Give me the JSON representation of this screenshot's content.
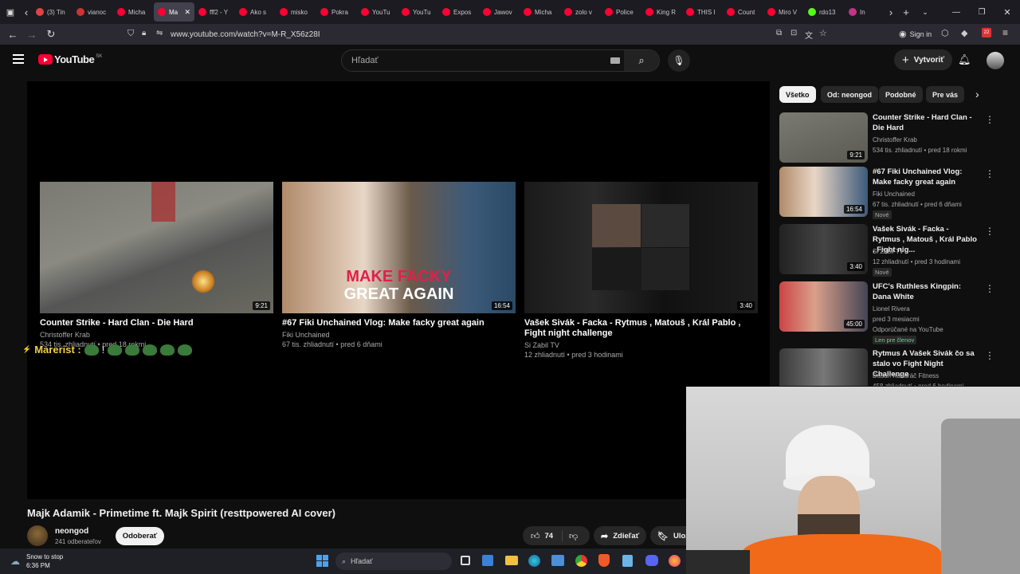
{
  "browser": {
    "tabs": [
      {
        "label": "(3) Tin",
        "color": "#d44"
      },
      {
        "label": "vianoc",
        "color": "#c33"
      },
      {
        "label": "Micha",
        "color": "#ff0033"
      },
      {
        "label": "Ma",
        "color": "#ff0033",
        "active": true
      },
      {
        "label": "fff2 - Y",
        "color": "#ff0033"
      },
      {
        "label": "Ako s",
        "color": "#ff0033"
      },
      {
        "label": "misko",
        "color": "#ff0033"
      },
      {
        "label": "Pokra",
        "color": "#ff0033"
      },
      {
        "label": "YouTu",
        "color": "#ff0033"
      },
      {
        "label": "YouTu",
        "color": "#ff0033"
      },
      {
        "label": "Expos",
        "color": "#ff0033"
      },
      {
        "label": "Jawov",
        "color": "#ff0033"
      },
      {
        "label": "Micha",
        "color": "#ff0033"
      },
      {
        "label": "zolo v",
        "color": "#ff0033"
      },
      {
        "label": "Police",
        "color": "#ff0033"
      },
      {
        "label": "King R",
        "color": "#ff0033"
      },
      {
        "label": "THIS I",
        "color": "#ff0033"
      },
      {
        "label": "Count",
        "color": "#ff0033"
      },
      {
        "label": "Miro V",
        "color": "#ff0033"
      },
      {
        "label": "rdo13",
        "color": "#53fc18"
      },
      {
        "label": "In",
        "color": "#c13584"
      }
    ],
    "url": "www.youtube.com/watch?v=M-R_X56z28I",
    "sign_in": "Sign in",
    "notif_count": "22"
  },
  "youtube": {
    "logo": "YouTube",
    "region": "SK",
    "search_placeholder": "Hľadať",
    "create_label": "Vytvoriť"
  },
  "end_screen": [
    {
      "title": "Counter Strike - Hard Clan - Die Hard",
      "channel": "Christoffer Krab",
      "stats": "534 tis. zhliadnutí • pred 18 rokmi",
      "duration": "9:21"
    },
    {
      "title": "#67 Fiki Unchained Vlog: Make facky great again",
      "channel": "Fiki Unchained",
      "stats": "67 tis. zhliadnutí • pred 6 dňami",
      "duration": "16:54",
      "overlay_line1": "MAKE FACKY",
      "overlay_line2": "GREAT AGAIN"
    },
    {
      "title": "Vašek Sivák - Facka - Rytmus , Matouš , Král Pablo , Fight night challenge",
      "channel": "Si Zabil TV",
      "stats": "12 zhliadnutí • pred 3 hodinami",
      "duration": "3:40"
    }
  ],
  "chat_overlay": {
    "name": "Marerist :",
    "text": "!"
  },
  "video": {
    "title": "Majk Adamik - Primetime ft. Majk Spirit (resttpowered AI cover)",
    "channel": "neongod",
    "subscribers": "241 odberateľov",
    "subscribe_label": "Odoberať",
    "likes": "74",
    "share_label": "Zdieľať",
    "save_label": "Ulož"
  },
  "chips": [
    {
      "label": "Všetko",
      "active": true
    },
    {
      "label": "Od: neongod"
    },
    {
      "label": "Podobné"
    },
    {
      "label": "Pre vás"
    }
  ],
  "sidebar": [
    {
      "title": "Counter Strike - Hard Clan - Die Hard",
      "channel": "Christoffer Krab",
      "stats": "534 tis. zhliadnutí • pred 18 rokmi",
      "duration": "9:21"
    },
    {
      "title": "#67 Fiki Unchained Vlog: Make facky great again",
      "channel": "Fiki Unchained",
      "stats": "67 tis. zhliadnutí • pred 6 dňami",
      "duration": "16:54",
      "badge": "Nové"
    },
    {
      "title": "Vašek Sivák - Facka - Rytmus , Matouš , Král Pablo , Fight nig...",
      "channel": "Si Zabil TV",
      "stats": "12 zhliadnutí • pred 3 hodinami",
      "duration": "3:40",
      "badge": "Nové"
    },
    {
      "title": "UFC's Ruthless Kingpin: Dana White",
      "channel": "Lionel Rivera",
      "stats": "pred 3 mesiacmi",
      "duration": "45:00",
      "extra": "Odporúčané na YouTube",
      "members": "Len pre členov"
    },
    {
      "title": "Rytmus A Vašek Sivák čo sa stalo vo Fight Night Challenge",
      "channel": "Dušan Kandráč Fitness",
      "stats": "458 zhliadnutí • pred 6 hodinami",
      "duration": ""
    }
  ],
  "taskbar": {
    "weather": "Snow to stop",
    "time": "6:36 PM",
    "search_placeholder": "Hľadať"
  }
}
